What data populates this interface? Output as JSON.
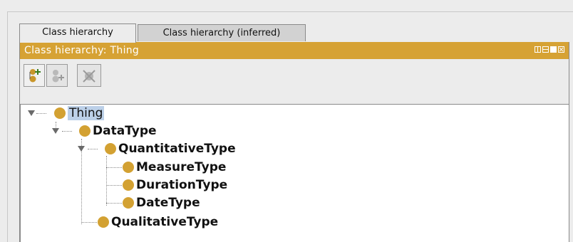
{
  "tabs": [
    {
      "label": "Class hierarchy",
      "active": true
    },
    {
      "label": "Class hierarchy (inferred)",
      "active": false
    }
  ],
  "view": {
    "title": "Class hierarchy: Thing",
    "title_bar_color": "#d6a234",
    "controls": [
      "split-view-icon",
      "minimize-icon",
      "maximize-icon",
      "close-icon"
    ]
  },
  "toolbar": {
    "buttons": [
      {
        "icon": "add-subclass-icon",
        "enabled": true
      },
      {
        "icon": "add-sibling-class-icon",
        "enabled": false
      },
      {
        "icon": "delete-class-icon",
        "enabled": false
      }
    ]
  },
  "tree": {
    "nodes": [
      {
        "label": "Thing",
        "depth": 0,
        "expanded": true,
        "selected": true
      },
      {
        "label": "DataType",
        "depth": 1,
        "expanded": true
      },
      {
        "label": "QuantitativeType",
        "depth": 2,
        "expanded": true
      },
      {
        "label": "MeasureType",
        "depth": 3
      },
      {
        "label": "DurationType",
        "depth": 3
      },
      {
        "label": "DateType",
        "depth": 3
      },
      {
        "label": "QualitativeType",
        "depth": 2
      }
    ],
    "class_icon_color": "#d3a132",
    "selection_color": "#bcd0e8"
  }
}
